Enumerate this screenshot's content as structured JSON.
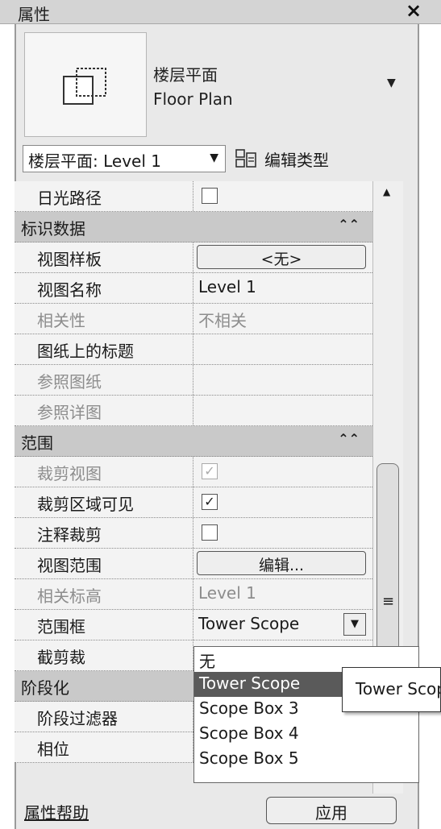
{
  "window": {
    "title": "属性",
    "close_label": "×"
  },
  "type_selector": {
    "name_zh": "楼层平面",
    "name_en": "Floor Plan",
    "dropdown_glyph": "▼",
    "icon": "floor-plan-icon"
  },
  "instance_selector": {
    "value": "楼层平面: Level 1",
    "arrow_glyph": "▼"
  },
  "edit_type": {
    "label": "编辑类型",
    "icon": "edit-type-icon"
  },
  "properties": [
    {
      "kind": "row",
      "label": "日光路径",
      "value_type": "checkbox",
      "checked": false,
      "dim": false
    },
    {
      "kind": "group",
      "label": "标识数据",
      "chevron": "⌃⌃"
    },
    {
      "kind": "row",
      "label": "视图样板",
      "value_type": "button",
      "value": "<无>",
      "dim": false
    },
    {
      "kind": "row",
      "label": "视图名称",
      "value_type": "text",
      "value": "Level 1",
      "dim": false
    },
    {
      "kind": "row",
      "label": "相关性",
      "value_type": "text",
      "value": "不相关",
      "dim": true
    },
    {
      "kind": "row",
      "label": "图纸上的标题",
      "value_type": "text",
      "value": "",
      "dim": false
    },
    {
      "kind": "row",
      "label": "参照图纸",
      "value_type": "text",
      "value": "",
      "dim": true
    },
    {
      "kind": "row",
      "label": "参照详图",
      "value_type": "text",
      "value": "",
      "dim": true
    },
    {
      "kind": "group",
      "label": "范围",
      "chevron": "⌃⌃"
    },
    {
      "kind": "row",
      "label": "裁剪视图",
      "value_type": "checkbox",
      "checked": true,
      "dim": true
    },
    {
      "kind": "row",
      "label": "裁剪区域可见",
      "value_type": "checkbox",
      "checked": true,
      "dim": false
    },
    {
      "kind": "row",
      "label": "注释裁剪",
      "value_type": "checkbox",
      "checked": false,
      "dim": false
    },
    {
      "kind": "row",
      "label": "视图范围",
      "value_type": "button",
      "value": "编辑...",
      "dim": false
    },
    {
      "kind": "row",
      "label": "相关标高",
      "value_type": "text",
      "value": "Level 1",
      "dim": true
    },
    {
      "kind": "row",
      "label": "范围框",
      "value_type": "combo",
      "value": "Tower Scope",
      "dim": false
    },
    {
      "kind": "row",
      "label": "截剪裁",
      "value_type": "text",
      "value": "",
      "dim": false
    },
    {
      "kind": "group",
      "label": "阶段化",
      "chevron": ""
    },
    {
      "kind": "row",
      "label": "阶段过滤器",
      "value_type": "text",
      "value": "",
      "dim": false
    },
    {
      "kind": "row",
      "label": "相位",
      "value_type": "text",
      "value": "",
      "dim": false
    }
  ],
  "scope_dropdown": {
    "options": [
      "无",
      "Tower Scope",
      "Scope Box 3",
      "Scope Box 4",
      "Scope Box 5"
    ],
    "selected_index": 1
  },
  "tooltip": {
    "text": "Tower Scope"
  },
  "scrollbar": {
    "up_glyph": "▲",
    "grip_glyph": "≡"
  },
  "footer": {
    "help_label": "属性帮助",
    "apply_label": "应用"
  }
}
